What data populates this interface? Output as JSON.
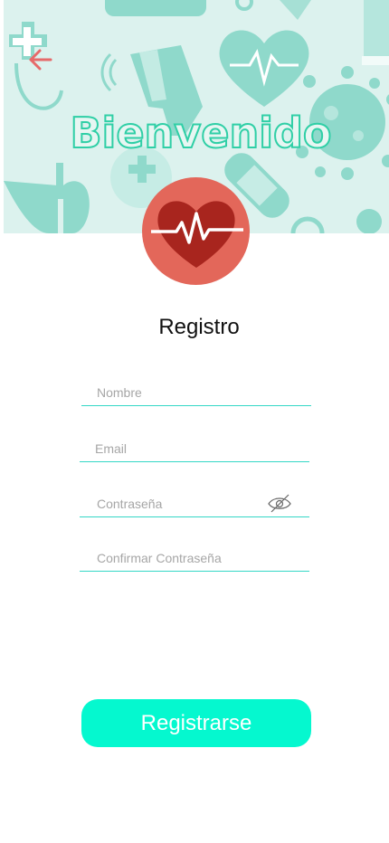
{
  "header": {
    "welcome_text": "Bienvenido",
    "back_icon": "arrow-left-icon",
    "logo_icon": "heart-pulse-icon"
  },
  "form": {
    "title": "Registro",
    "name_placeholder": "Nombre",
    "email_placeholder": "Email",
    "password_placeholder": "Contraseña",
    "password_toggle_icon": "eye-off-icon",
    "confirm_placeholder": "Confirmar Contraseña",
    "submit_label": "Registrarse"
  },
  "colors": {
    "accent": "#05f8cf",
    "banner_bg": "#dcf2ee",
    "banner_shapes": "#8fd9cb",
    "logo_bg": "#e3675a",
    "heart": "#a8251e",
    "back_arrow": "#e66a6a",
    "field_line": "#34d7c6"
  }
}
